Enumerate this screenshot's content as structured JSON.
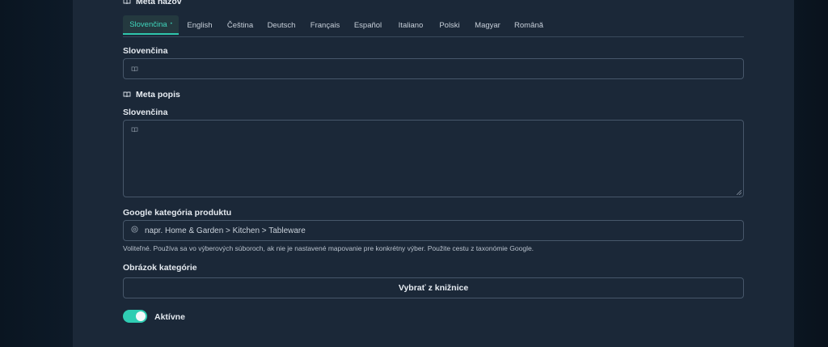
{
  "meta_title": {
    "heading": "Meta názov",
    "icon": "book-icon"
  },
  "tabs": [
    {
      "label": "Slovenčina",
      "active": true
    },
    {
      "label": "English"
    },
    {
      "label": "Čeština"
    },
    {
      "label": "Deutsch"
    },
    {
      "label": "Français"
    },
    {
      "label": "Español"
    },
    {
      "label": "Italiano"
    },
    {
      "label": "Polski"
    },
    {
      "label": "Magyar"
    },
    {
      "label": "Română"
    }
  ],
  "active_tab_marker": "•",
  "meta_title_field": {
    "label": "Slovenčina",
    "value": ""
  },
  "meta_description": {
    "heading": "Meta popis",
    "label": "Slovenčina",
    "value": ""
  },
  "google_category": {
    "label": "Google kategória produktu",
    "placeholder": "napr. Home & Garden > Kitchen > Tableware",
    "hint": "Voliteľné. Používa sa vo výberových súboroch, ak nie je nastavené mapovanie pre konkrétny výber. Použite cestu z taxonómie Google."
  },
  "category_image": {
    "label": "Obrázok kategórie",
    "button_label": "Vybrať z knižnice"
  },
  "active_toggle": {
    "label": "Aktívne",
    "on": true
  },
  "colors": {
    "accent": "#2fcdb3",
    "panel": "#1b2838",
    "border": "#47576a"
  }
}
